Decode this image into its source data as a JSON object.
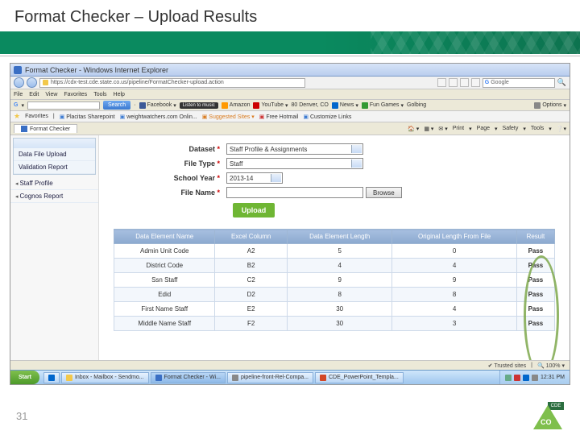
{
  "slide": {
    "title": "Format Checker – Upload Results",
    "page_number": "31",
    "logo_text": "CDE",
    "logo_state": "CO"
  },
  "browser": {
    "window_title": "Format Checker - Windows Internet Explorer",
    "url": "https://cdx-test.cde.state.co.us/pipeline/FormatChecker-upload.action",
    "search_placeholder": "Google",
    "menu": [
      "File",
      "Edit",
      "View",
      "Favorites",
      "Tools",
      "Help"
    ],
    "google_tb": {
      "search_btn": "Search",
      "items": [
        "Facebook",
        "Listen to music",
        "Amazon",
        "YouTube",
        "80 Denver, CO",
        "News",
        "Fun Games",
        "Golbing"
      ],
      "options": "Options"
    },
    "favorites": {
      "label": "Favorites",
      "items": [
        "Placitas Sharepoint",
        "weightwatchers.com Onlin...",
        "Suggested Sites",
        "Free Hotmail",
        "Customize Links"
      ]
    },
    "tabs": {
      "active": "Format Checker",
      "right": [
        "Home",
        "Feeds",
        "Print",
        "Page",
        "Safety",
        "Tools"
      ]
    }
  },
  "sidebar": {
    "items": [
      {
        "label": "Data File Upload"
      },
      {
        "label": "Validation Report"
      },
      {
        "label": "Staff Profile",
        "bullet": true
      },
      {
        "label": "Cognos Report",
        "bullet": true
      }
    ]
  },
  "form": {
    "dataset": {
      "label": "Dataset",
      "value": "Staff Profile & Assignments"
    },
    "filetype": {
      "label": "File Type",
      "value": "Staff"
    },
    "schoolyear": {
      "label": "School Year",
      "value": "2013-14"
    },
    "filename": {
      "label": "File Name",
      "browse": "Browse"
    },
    "upload_btn": "Upload"
  },
  "table": {
    "headers": [
      "Data Element Name",
      "Excel Column",
      "Data Element Length",
      "Original Length From File",
      "Result"
    ],
    "rows": [
      {
        "name": "Admin Unit Code",
        "col": "A2",
        "len": "5",
        "orig": "0",
        "result": "Pass"
      },
      {
        "name": "District Code",
        "col": "B2",
        "len": "4",
        "orig": "4",
        "result": "Pass"
      },
      {
        "name": "Ssn Staff",
        "col": "C2",
        "len": "9",
        "orig": "9",
        "result": "Pass"
      },
      {
        "name": "Edid",
        "col": "D2",
        "len": "8",
        "orig": "8",
        "result": "Pass"
      },
      {
        "name": "First Name Staff",
        "col": "E2",
        "len": "30",
        "orig": "4",
        "result": "Pass"
      },
      {
        "name": "Middle Name Staff",
        "col": "F2",
        "len": "30",
        "orig": "3",
        "result": "Pass"
      }
    ]
  },
  "statusbar": {
    "trusted": "Trusted sites",
    "zoom": "100%"
  },
  "taskbar": {
    "start": "Start",
    "buttons": [
      "",
      "Inbox - Mailbox - Sendmo...",
      "Format Checker - Wi...",
      "pipeline-front-Rel-Compa...",
      "CDE_PowerPoint_Templa..."
    ],
    "clock": "12:31 PM"
  }
}
